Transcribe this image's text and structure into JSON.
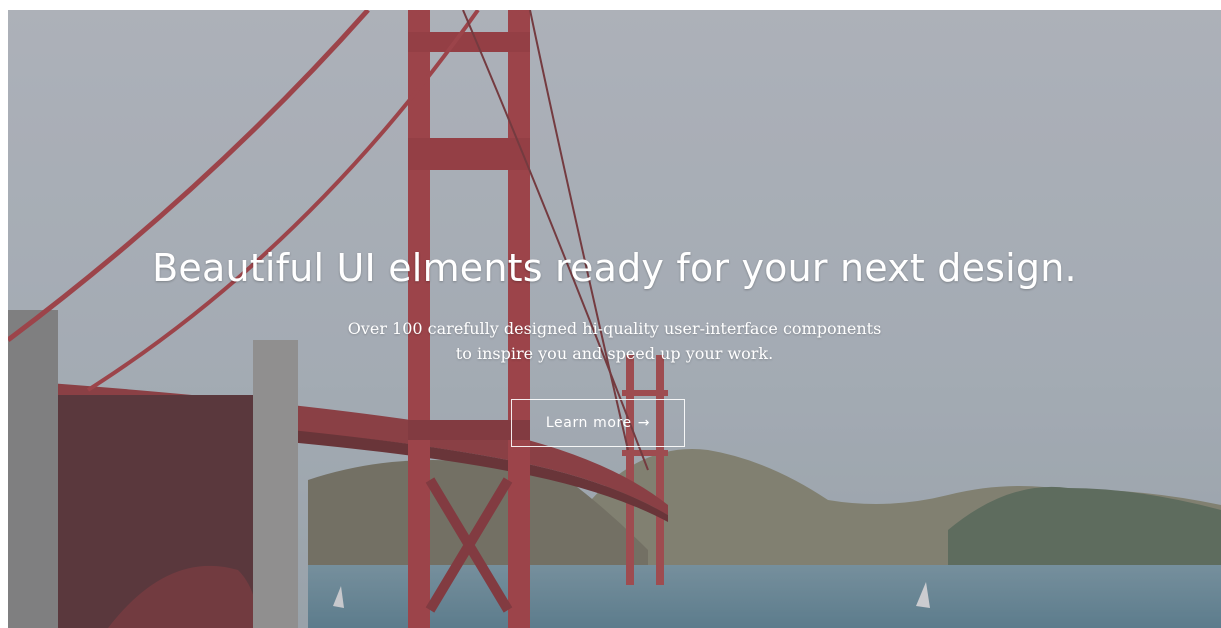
{
  "hero": {
    "headline": "Beautiful UI elments ready for your next design.",
    "subtext": "Over 100 carefully designed hi-quality user-interface components to inspire you and speed up your work.",
    "cta_label": "Learn more",
    "cta_arrow": "→",
    "background_image": "golden-gate-bridge-photo",
    "colors": {
      "text": "#ffffff",
      "bridge": "#b33a3a",
      "sky": "#c3c9cf",
      "water": "#6d94a6",
      "hills": "#8a8a6a"
    }
  }
}
